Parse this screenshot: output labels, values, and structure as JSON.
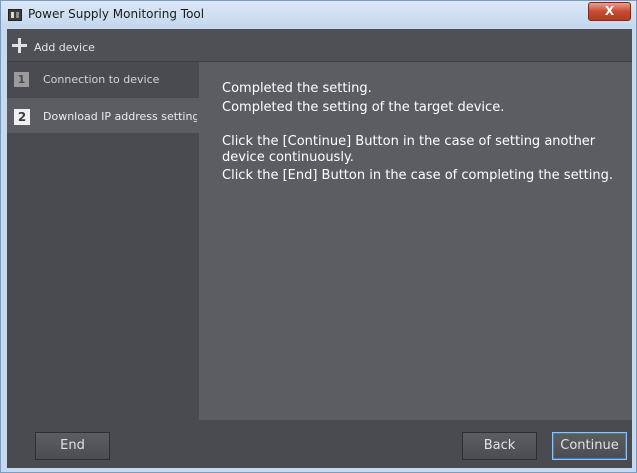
{
  "window": {
    "title": "Power Supply Monitoring Tool",
    "close_label": "X"
  },
  "toolbar": {
    "add_device_label": "Add device"
  },
  "sidebar": {
    "steps": [
      {
        "number": "1",
        "label": "Connection to device",
        "active": false
      },
      {
        "number": "2",
        "label": "Download IP address setting",
        "active": true
      }
    ]
  },
  "content": {
    "line1": "Completed the setting.",
    "line2": "Completed the setting of the target device.",
    "line3": "Click the [Continue] Button in the case of setting another device continuously.",
    "line4": "Click the [End] Button in the case of completing the setting."
  },
  "footer": {
    "end_label": "End",
    "back_label": "Back",
    "continue_label": "Continue"
  }
}
